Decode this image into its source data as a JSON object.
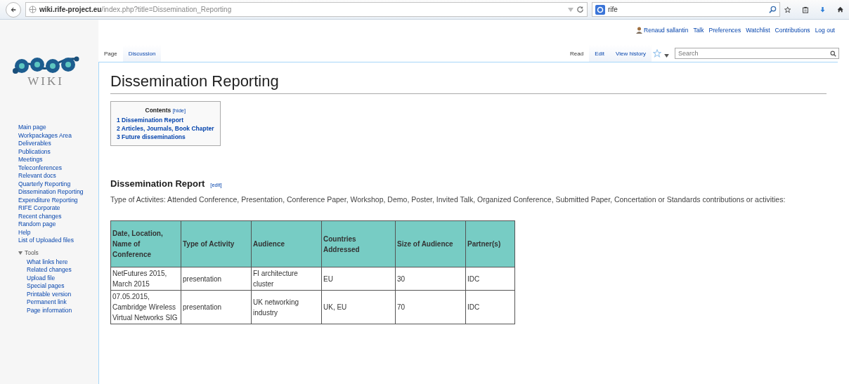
{
  "browser": {
    "url_host": "wiki.rife-project.eu",
    "url_path": "/index.php?title=Dissemination_Reporting",
    "search_value": "rife"
  },
  "personal_links": [
    "Renaud sallantin",
    "Talk",
    "Preferences",
    "Watchlist",
    "Contributions",
    "Log out"
  ],
  "logo": {
    "text": "WIKI"
  },
  "namespace_tabs": [
    {
      "label": "Page",
      "selected": true
    },
    {
      "label": "Discussion",
      "selected": false
    }
  ],
  "view_tabs": [
    {
      "label": "Read",
      "selected": true
    },
    {
      "label": "Edit",
      "selected": false
    },
    {
      "label": "View history",
      "selected": false
    }
  ],
  "search": {
    "placeholder": "Search"
  },
  "sidebar": {
    "items": [
      {
        "label": "Main page"
      },
      {
        "label": "Workpackages Area"
      },
      {
        "label": "Deliverables"
      },
      {
        "label": "Publications"
      },
      {
        "label": "Meetings"
      },
      {
        "label": "Teleconferences"
      },
      {
        "label": "Relevant docs"
      },
      {
        "label": "Quarterly Reporting"
      },
      {
        "label": "Dissemination Reporting"
      },
      {
        "label": "Expenditure Reporting"
      },
      {
        "label": "RIFE Corporate"
      },
      {
        "label": "Recent changes"
      },
      {
        "label": "Random page"
      },
      {
        "label": "Help"
      },
      {
        "label": "List of Uploaded files"
      }
    ],
    "tools": {
      "label": "Tools",
      "expanded": true,
      "children": [
        {
          "label": "What links here"
        },
        {
          "label": "Related changes"
        },
        {
          "label": "Upload file"
        },
        {
          "label": "Special pages"
        },
        {
          "label": "Printable version"
        },
        {
          "label": "Permanent link"
        },
        {
          "label": "Page information"
        }
      ]
    }
  },
  "page_title": "Dissemination Reporting",
  "toc": {
    "title": "Contents",
    "toggle": "[hide]",
    "items": [
      {
        "number": "1",
        "label": "Dissemination Report"
      },
      {
        "number": "2",
        "label": "Articles, Journals, Book Chapter"
      },
      {
        "number": "3",
        "label": "Future disseminations"
      }
    ]
  },
  "section": {
    "heading": "Dissemination Report",
    "edit": "[edit]",
    "text": "Type of Activites: Attended Conference, Presentation, Conference Paper, Workshop, Demo, Poster, Invited Talk, Organized Conference, Submitted Paper, Concertation or Standards contributions or activities:"
  },
  "table": {
    "columns": [
      "Date, Location, Name of Conference",
      "Type of Activity",
      "Audience",
      "Countries Addressed",
      "Size of Audience",
      "Partner(s)"
    ],
    "rows": [
      [
        "NetFutures 2015, March 2015",
        "presentation",
        "FI architecture cluster",
        "EU",
        "30",
        "IDC"
      ],
      [
        "07.05.2015, Cambridge Wireless Virtual Networks SIG",
        "presentation",
        "UK networking industry",
        "UK, EU",
        "70",
        "IDC"
      ]
    ]
  }
}
